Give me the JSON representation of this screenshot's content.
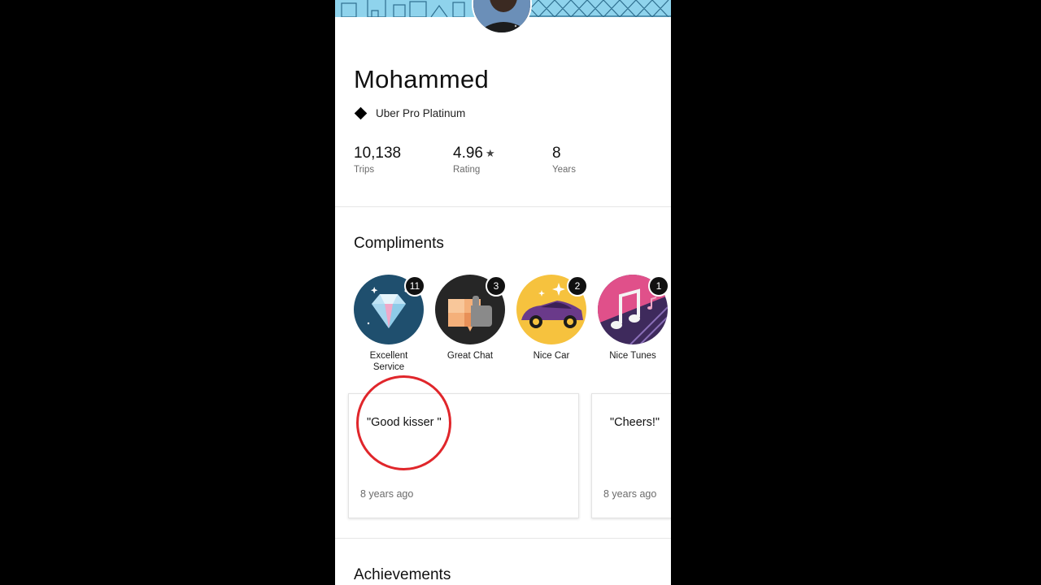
{
  "profile": {
    "name": "Mohammed",
    "tier": "Uber Pro Platinum",
    "stats": [
      {
        "value": "10,138",
        "label": "Trips",
        "star": ""
      },
      {
        "value": "4.96",
        "label": "Rating",
        "star": "★"
      },
      {
        "value": "8",
        "label": "Years",
        "star": ""
      }
    ]
  },
  "compliments": {
    "title": "Compliments",
    "badges": [
      {
        "label": "Excellent Service",
        "count": "11",
        "icon": "diamond-icon"
      },
      {
        "label": "Great Chat",
        "count": "3",
        "icon": "thumbs-up-icon"
      },
      {
        "label": "Nice Car",
        "count": "2",
        "icon": "car-icon"
      },
      {
        "label": "Nice Tunes",
        "count": "1",
        "icon": "music-note-icon"
      }
    ],
    "comments": [
      {
        "quote": "\"Good kisser  \"",
        "when": "8 years ago"
      },
      {
        "quote": "\"Cheers!\"",
        "when": "8 years ago"
      }
    ]
  },
  "achievements": {
    "title": "Achievements"
  },
  "colors": {
    "annotation_circle": "#e0262b",
    "banner": "#8fd3ec"
  }
}
